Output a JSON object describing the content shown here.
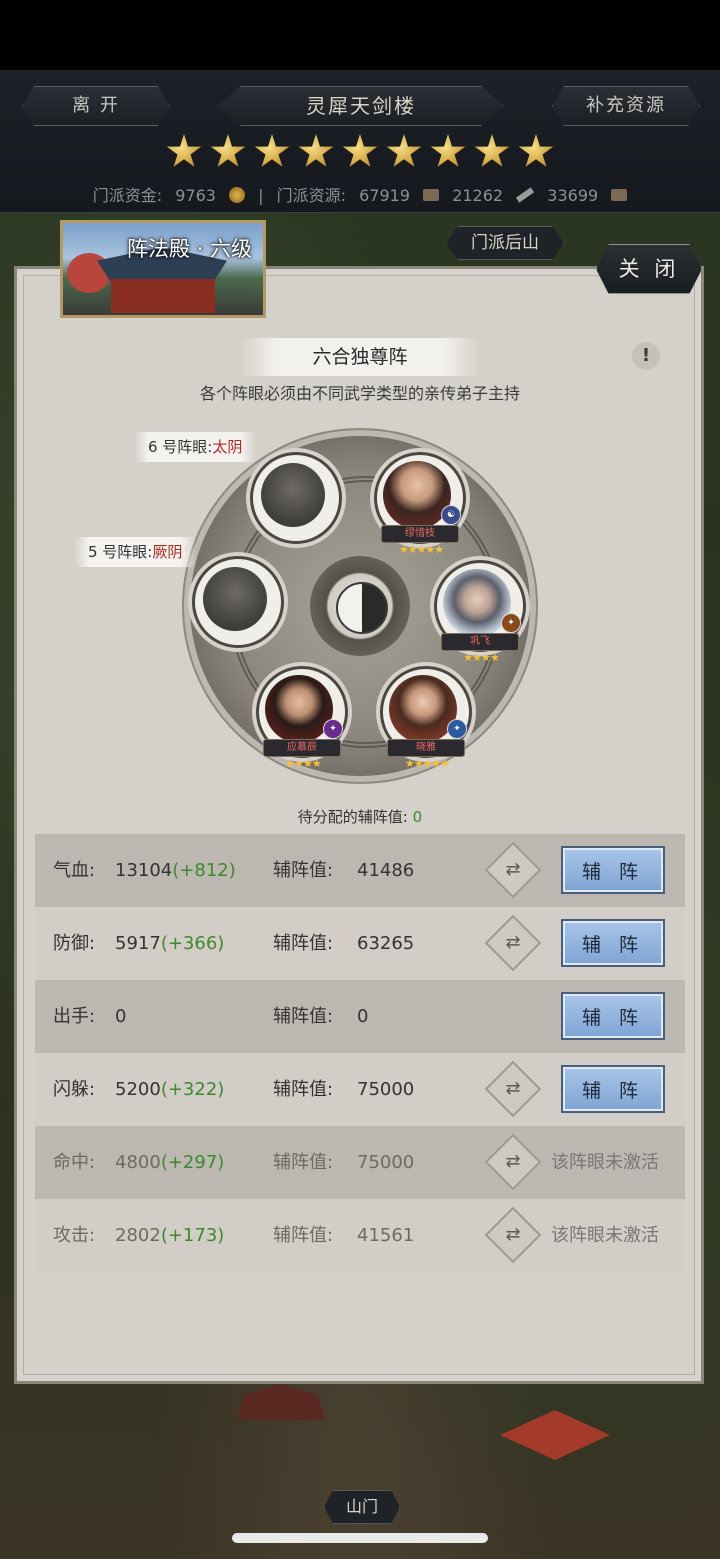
{
  "header": {
    "leave_label": "离 开",
    "title": "灵犀天剑楼",
    "supply_label": "补充资源",
    "star_count": 9,
    "resources": [
      {
        "label": "门派资金:",
        "value": "9763",
        "icon": "coin-icon"
      },
      {
        "label": "门派资源:",
        "value": "67919",
        "icon": "resource-icon"
      },
      {
        "label": "",
        "value": "21262",
        "icon": "sword-icon"
      },
      {
        "label": "",
        "value": "33699",
        "icon": "scroll-icon"
      }
    ],
    "mountain_tag": "门派后山"
  },
  "hall": {
    "title": "阵法殿 · 六级",
    "close_label": "关 闭"
  },
  "formation": {
    "name": "六合独尊阵",
    "description": "各个阵眼必须由不同武学类型的亲传弟子主持",
    "info_icon": "!",
    "eye_labels": [
      {
        "prefix": "6 号阵眼:",
        "attr": "太阴"
      },
      {
        "prefix": "5 号阵眼:",
        "attr": "厥阴"
      }
    ],
    "heroes": [
      {
        "name": "缪惜枝",
        "stars": "★★★★★"
      },
      {
        "name": "巩飞",
        "stars": "★★★★"
      },
      {
        "name": "晓雅",
        "stars": "★★★★★"
      },
      {
        "name": "应慕辰",
        "stars": "★★★★"
      }
    ],
    "pending_label": "待分配的辅阵值:",
    "pending_value": "0"
  },
  "stats": [
    {
      "name": "气血:",
      "value": "13104",
      "bonus": "(+812)",
      "aux_label": "辅阵值:",
      "aux_value": "41486",
      "active": true,
      "button": "辅 阵",
      "swap": true
    },
    {
      "name": "防御:",
      "value": "5917",
      "bonus": "(+366)",
      "aux_label": "辅阵值:",
      "aux_value": "63265",
      "active": true,
      "button": "辅 阵",
      "swap": true
    },
    {
      "name": "出手:",
      "value": "0",
      "bonus": "",
      "aux_label": "辅阵值:",
      "aux_value": "0",
      "active": true,
      "button": "辅 阵",
      "swap": false
    },
    {
      "name": "闪躲:",
      "value": "5200",
      "bonus": "(+322)",
      "aux_label": "辅阵值:",
      "aux_value": "75000",
      "active": true,
      "button": "辅 阵",
      "swap": true
    },
    {
      "name": "命中:",
      "value": "4800",
      "bonus": "(+297)",
      "aux_label": "辅阵值:",
      "aux_value": "75000",
      "active": false,
      "inactive_text": "该阵眼未激活",
      "swap": true
    },
    {
      "name": "攻击:",
      "value": "2802",
      "bonus": "(+173)",
      "aux_label": "辅阵值:",
      "aux_value": "41561",
      "active": false,
      "inactive_text": "该阵眼未激活",
      "swap": true
    }
  ],
  "footer": {
    "gate_tag": "山门"
  },
  "colors": {
    "bonus_green": "#3b8a2c",
    "attr_red": "#b3261e",
    "button_blue": "#7fa4d3",
    "star_gold": "#f2c236"
  }
}
